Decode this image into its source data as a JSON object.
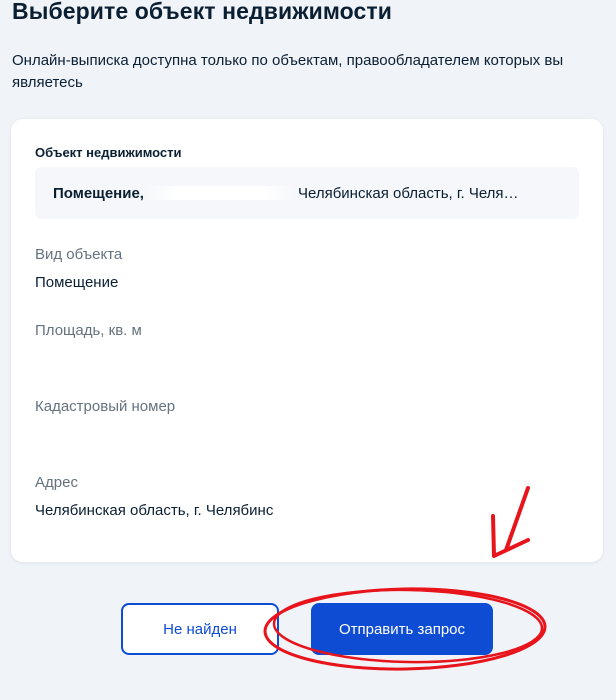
{
  "header": {
    "title": "Выберите объект недвижимости",
    "subtitle": "Онлайн-выписка доступна только по объектам, правообладателем которых вы являетесь"
  },
  "card": {
    "object_label": "Объект недвижимости",
    "select": {
      "prefix": "Помещение,",
      "address": "Челябинская область, г. Челя…"
    },
    "fields": {
      "type_label": "Вид объекта",
      "type_value": "Помещение",
      "area_label": "Площадь, кв. м",
      "area_value": "",
      "cadastral_label": "Кадастровый номер",
      "cadastral_value": "",
      "address_label": "Адрес",
      "address_value": "Челябинская область, г. Челябинс"
    }
  },
  "actions": {
    "not_found_label": "Не найден",
    "submit_label": "Отправить запрос"
  },
  "colors": {
    "accent": "#0d4cd3",
    "annotation": "#e8141b",
    "background": "#f0f4f9"
  }
}
